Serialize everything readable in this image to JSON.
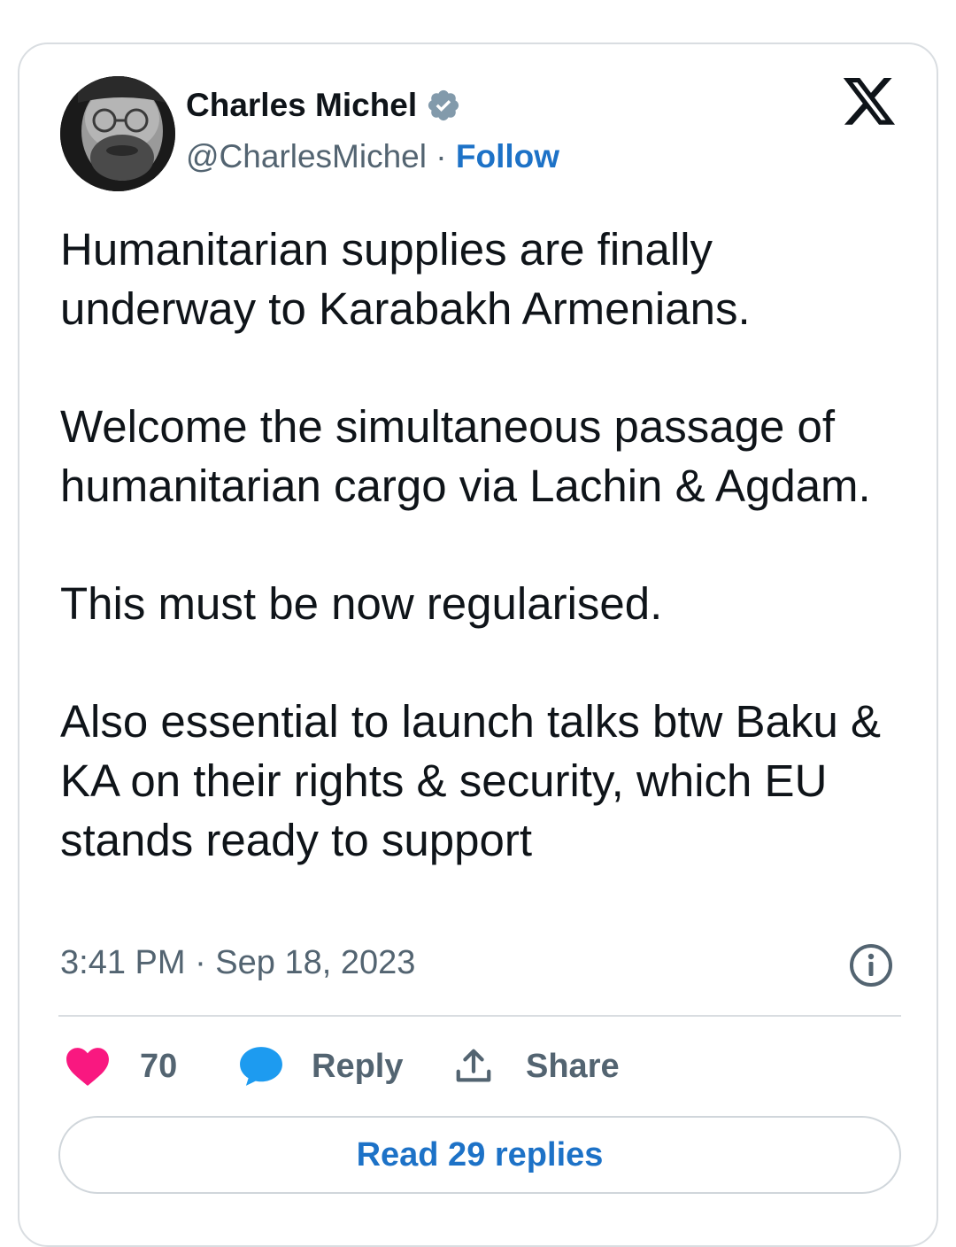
{
  "author": {
    "name": "Charles Michel",
    "handle": "@CharlesMichel",
    "separator": " · ",
    "follow_label": "Follow"
  },
  "tweet": {
    "paragraphs": [
      "Humanitarian supplies are finally underway to Karabakh Armenians.",
      "Welcome the simultaneous passage of humanitarian cargo via Lachin & Agdam.",
      "This must be now regularised.",
      "Also essential to launch talks btw Baku & KA on their rights & security, which EU stands ready to support"
    ],
    "timestamp": "3:41 PM · Sep 18, 2023"
  },
  "actions": {
    "like_count": "70",
    "reply_label": "Reply",
    "share_label": "Share"
  },
  "read_replies_label": "Read 29 replies",
  "colors": {
    "like": "#f91880",
    "reply": "#1d9bf0",
    "link": "#1d72c7",
    "muted": "#536471",
    "text": "#0f1419",
    "border": "#d9dde1"
  },
  "icons": [
    "verified-badge-icon",
    "x-logo-icon",
    "info-icon",
    "heart-icon",
    "reply-bubble-icon",
    "share-icon"
  ]
}
